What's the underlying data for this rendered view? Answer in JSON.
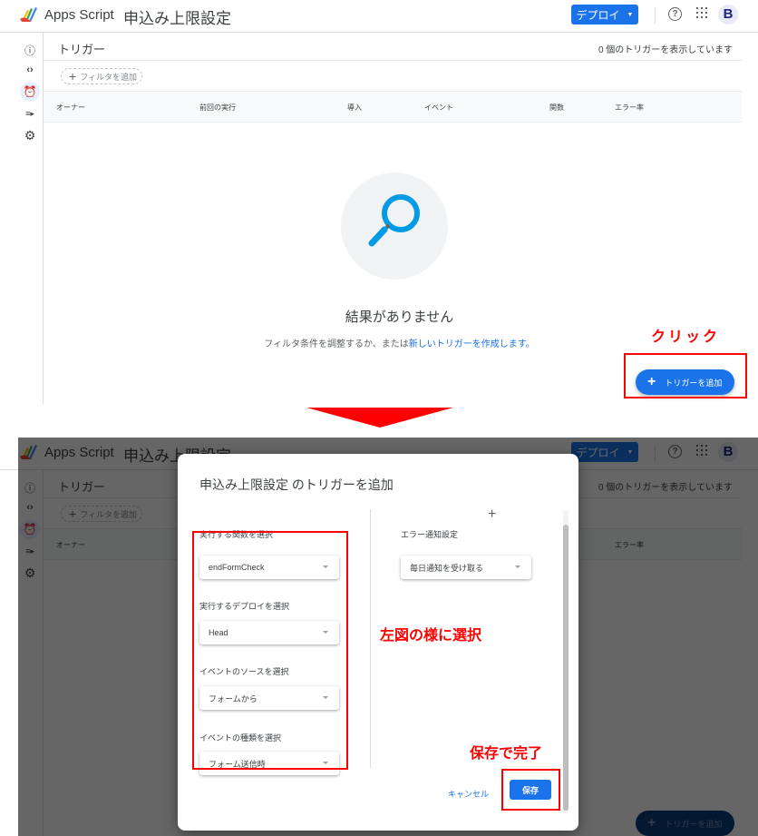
{
  "app": {
    "name": "Apps Script",
    "project": "申込み上限設定",
    "deploy_label": "デプロイ",
    "help_glyph": "?",
    "avatar_initial": "B"
  },
  "sidebar": {
    "items": [
      {
        "name": "overview",
        "icon": "info-icon",
        "glyph": "ⓘ"
      },
      {
        "name": "editor",
        "icon": "code-icon",
        "glyph": "‹›"
      },
      {
        "name": "triggers",
        "icon": "alarm-clock-icon",
        "glyph": "⏰",
        "active": true
      },
      {
        "name": "executions",
        "icon": "executions-list-icon",
        "glyph": "≡▸"
      },
      {
        "name": "settings",
        "icon": "gear-icon",
        "glyph": "⚙"
      }
    ]
  },
  "triggers_page": {
    "title": "トリガー",
    "count_text": "0 個のトリガーを表示しています",
    "filter_label": "フィルタを追加",
    "columns": [
      "オーナー",
      "前回の実行",
      "導入",
      "イベント",
      "関数",
      "エラー率"
    ],
    "empty_title": "結果がありません",
    "empty_sub_prefix": "フィルタ条件を調整するか、または",
    "empty_sub_link": "新しいトリガーを作成します。",
    "add_trigger_label": "トリガーを追加"
  },
  "dialog": {
    "title": "申込み上限設定 のトリガーを追加",
    "function_label": "実行する関数を選択",
    "function_value": "endFormCheck",
    "deploy_label": "実行するデプロイを選択",
    "deploy_value": "Head",
    "source_label": "イベントのソースを選択",
    "source_value": "フォームから",
    "type_label": "イベントの種類を選択",
    "type_value": "フォーム送信時",
    "error_label": "エラー通知設定",
    "error_value": "毎日通知を受け取る",
    "cancel_label": "キャンセル",
    "save_label": "保存"
  },
  "annotations": {
    "click": "クリック",
    "select_as_shown": "左図の様に選択",
    "save_to_finish": "保存で完了",
    "accent_color": "#ff0000"
  },
  "colors": {
    "primary": "#1a73e8",
    "text": "#3c4043"
  }
}
